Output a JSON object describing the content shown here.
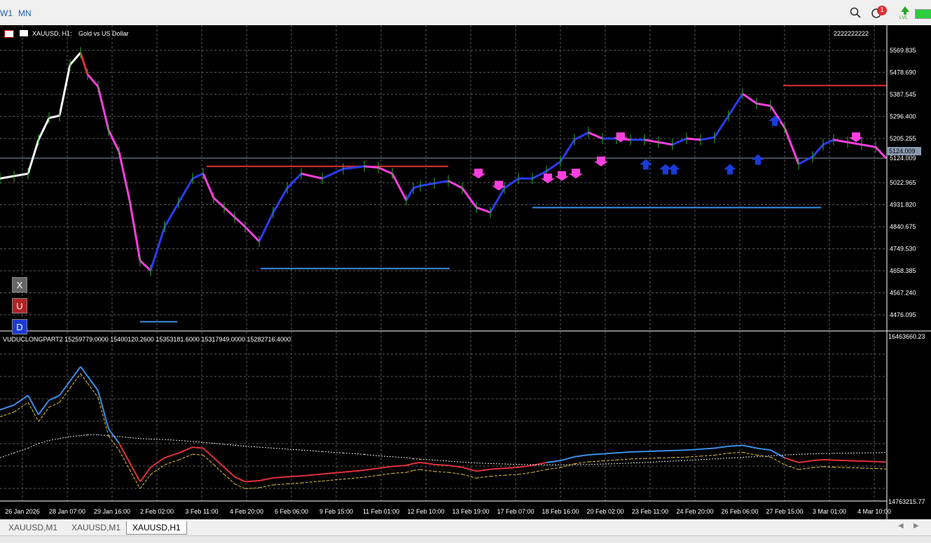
{
  "toolbar": {
    "timeframes": [
      "W1",
      "MN"
    ],
    "notification_count": "1",
    "lvl_label": "LVL"
  },
  "chart": {
    "title": "XAUUSD, H1:",
    "subtitle": "Gold vs US Dollar",
    "account": "2222222222",
    "current_price": "5124.009",
    "price_ticks": [
      "5569.835",
      "5478.690",
      "5387.545",
      "5296.400",
      "5205.255",
      "5124.009",
      "5022.965",
      "4931.820",
      "4840.675",
      "4749.530",
      "4658.385",
      "4567.240",
      "4476.095"
    ],
    "time_ticks": [
      "26 Jan 2026",
      "28 Jan 07:00",
      "29 Jan 16:00",
      "2 Feb 02:00",
      "3 Feb 11:00",
      "4 Feb 20:00",
      "6 Feb 06:00",
      "9 Feb 15:00",
      "11 Feb 01:00",
      "12 Feb 10:00",
      "13 Feb 19:00",
      "17 Feb 07:00",
      "18 Feb 16:00",
      "20 Feb 02:00",
      "23 Feb 11:00",
      "24 Feb 20:00",
      "26 Feb 06:00",
      "27 Feb 15:00",
      "3 Mar 01:00",
      "4 Mar 10:00"
    ],
    "buttons": {
      "x": "X",
      "u": "U",
      "d": "D"
    }
  },
  "indicator": {
    "header": "VUDUCLONGPART2 15259779.0000 15400120.2600 15353181.6000 15317949.0000 15282716.4000",
    "top_value": "16463660.23",
    "bottom_value": "14763215.77"
  },
  "tabs": [
    "XAUUSD,M1",
    "XAUUSD,M1",
    "XAUUSD,H1"
  ],
  "chart_data": {
    "type": "line",
    "title": "XAUUSD, H1:",
    "ylim": [
      4430,
      5610
    ],
    "x": [
      0,
      20,
      40,
      55,
      70,
      85,
      100,
      115,
      125,
      140,
      155,
      170,
      185,
      200,
      215,
      235,
      255,
      275,
      290,
      305,
      320,
      335,
      350,
      370,
      390,
      410,
      430,
      460,
      490,
      520,
      540,
      560,
      580,
      590,
      600,
      620,
      640,
      660,
      680,
      700,
      720,
      740,
      760,
      780,
      800,
      820,
      840,
      860,
      880,
      900,
      920,
      940,
      960,
      980,
      1000,
      1020,
      1040,
      1060,
      1080,
      1100,
      1120,
      1140,
      1160,
      1175,
      1190,
      1210,
      1230,
      1250,
      1265
    ],
    "series": [
      {
        "values": [
          5040,
          5050,
          5060,
          5200,
          5290,
          5300,
          5510,
          5560,
          5470,
          5420,
          5240,
          5150,
          4950,
          4700,
          4660,
          4840,
          4940,
          5040,
          5060,
          4960,
          4920,
          4880,
          4840,
          4780,
          4900,
          5000,
          5060,
          5040,
          5080,
          5090,
          5085,
          5060,
          4950,
          5000,
          5010,
          5020,
          5030,
          5000,
          4920,
          4900,
          5000,
          5040,
          5040,
          5070,
          5110,
          5200,
          5230,
          5205,
          5205,
          5200,
          5200,
          5190,
          5180,
          5205,
          5200,
          5210,
          5300,
          5390,
          5350,
          5340,
          5250,
          5100,
          5130,
          5180,
          5200,
          5190,
          5180,
          5170,
          5124
        ]
      }
    ],
    "levels": [
      {
        "price": 5424,
        "color": "#e03030"
      },
      {
        "price": 5090,
        "color": "#e03030"
      },
      {
        "price": 4920,
        "color": "#3a8ee6"
      },
      {
        "price": 4668,
        "color": "#3a8ee6"
      },
      {
        "price": 4448,
        "color": "#3a8ee6"
      }
    ],
    "down_arrows": [
      [
        683,
        5040
      ],
      [
        712,
        4990
      ],
      [
        782,
        5020
      ],
      [
        802,
        5030
      ],
      [
        822,
        5040
      ],
      [
        858,
        5090
      ],
      [
        886,
        5190
      ],
      [
        1222,
        5190
      ]
    ],
    "up_arrows": [
      [
        922,
        5120
      ],
      [
        950,
        5100
      ],
      [
        962,
        5100
      ],
      [
        1042,
        5100
      ],
      [
        1082,
        5140
      ],
      [
        1106,
        5300
      ]
    ],
    "indicator_series": [
      {
        "name": "main",
        "values": [
          15700000,
          15750000,
          15850000,
          15650000,
          15800000,
          15850000,
          16000000,
          16150000,
          16050000,
          15900000,
          15500000,
          15350000,
          15150000,
          14950000,
          15100000,
          15200000,
          15250000,
          15310000,
          15300000,
          15200000,
          15100000,
          15000000,
          14950000,
          14960000,
          14990000,
          15000000,
          15010000,
          15030000,
          15050000,
          15070000,
          15090000,
          15110000,
          15120000,
          15140000,
          15150000,
          15130000,
          15120000,
          15100000,
          15060000,
          15080000,
          15090000,
          15100000,
          15120000,
          15150000,
          15170000,
          15210000,
          15230000,
          15240000,
          15250000,
          15260000,
          15265000,
          15270000,
          15275000,
          15280000,
          15290000,
          15300000,
          15320000,
          15330000,
          15300000,
          15280000,
          15200000,
          15150000,
          15170000,
          15180000,
          15175000,
          15170000,
          15165000,
          15160000,
          15155000
        ]
      },
      {
        "name": "ma",
        "values": [
          15200000,
          15250000,
          15300000,
          15350000,
          15380000,
          15400000,
          15420000,
          15430000,
          15440000,
          15440000,
          15430000,
          15420000,
          15410000,
          15400000,
          15395000,
          15390000,
          15380000,
          15370000,
          15360000,
          15350000,
          15340000,
          15330000,
          15320000,
          15310000,
          15300000,
          15290000,
          15280000,
          15265000,
          15250000,
          15235000,
          15220000,
          15210000,
          15200000,
          15190000,
          15185000,
          15175000,
          15165000,
          15155000,
          15145000,
          15140000,
          15135000,
          15130000,
          15128000,
          15126000,
          15126000,
          15128000,
          15130000,
          15134000,
          15138000,
          15145000,
          15150000,
          15158000,
          15165000,
          15172000,
          15180000,
          15188000,
          15196000,
          15205000,
          15212000,
          15220000,
          15228000,
          15236000,
          15240000,
          15244000,
          15246000,
          15248000,
          15250000,
          15252000,
          15254000
        ]
      }
    ]
  }
}
